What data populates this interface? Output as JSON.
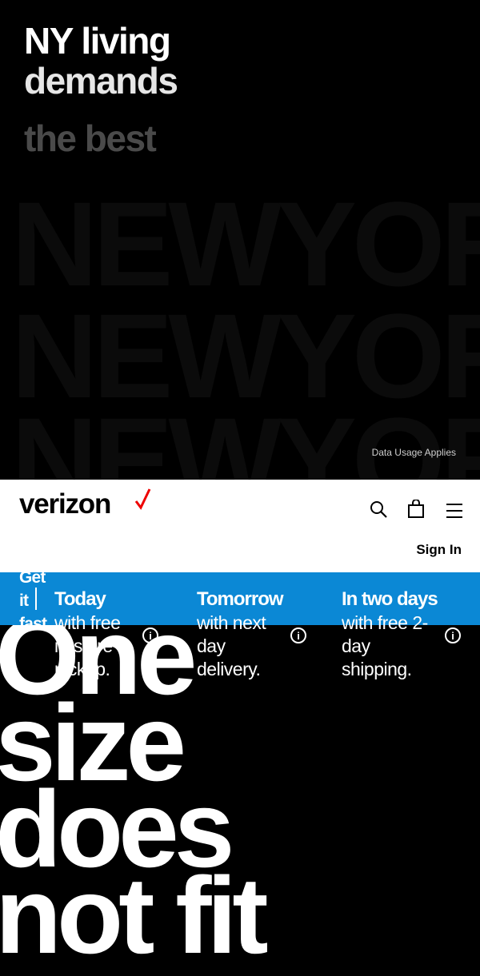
{
  "hero": {
    "line1": "NY living",
    "line2": "demands",
    "line3": "the best",
    "data_usage": "Data Usage Applies"
  },
  "header": {
    "logo": "verizon",
    "search_icon": "search-icon",
    "bag_icon": "shopping-bag-icon",
    "menu_icon": "hamburger-menu-icon",
    "sign_in": "Sign In"
  },
  "shipping": {
    "label": "Get\nit\nfast.",
    "options": [
      {
        "title": "Today",
        "description": "with free\nin-store\npickup."
      },
      {
        "title": "Tomorrow",
        "description": "with next\nday\ndelivery."
      },
      {
        "title": "In two days",
        "description": "with free 2-\nday\nshipping."
      }
    ],
    "info_icon": "info-icon"
  },
  "below": {
    "text": "One\nsize\ndoes\nnot fit"
  },
  "colors": {
    "brand_red": "#ee0000",
    "ship_bar": "#0b88d5"
  }
}
